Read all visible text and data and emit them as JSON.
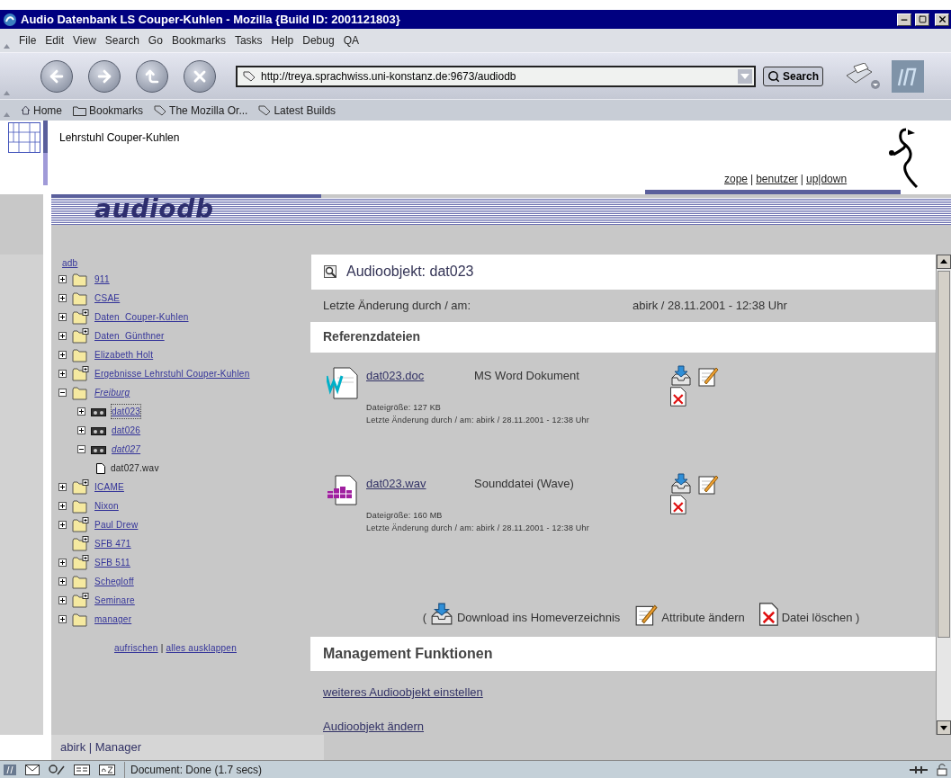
{
  "window": {
    "title": "Audio Datenbank LS Couper-Kuhlen - Mozilla {Build ID: 2001121803}"
  },
  "menu": [
    "File",
    "Edit",
    "View",
    "Search",
    "Go",
    "Bookmarks",
    "Tasks",
    "Help",
    "Debug",
    "QA"
  ],
  "toolbar": {
    "url": "http://treya.sprachwiss.uni-konstanz.de:9673/audiodb",
    "search_button": "Search"
  },
  "personal_bar": [
    {
      "label": "Home",
      "kind": "home"
    },
    {
      "label": "Bookmarks",
      "kind": "folder"
    },
    {
      "label": "The Mozilla Or...",
      "kind": "link"
    },
    {
      "label": "Latest Builds",
      "kind": "link"
    }
  ],
  "header": {
    "title": "Lehrstuhl Couper-Kuhlen",
    "links": [
      "zope",
      "benutzer",
      "up|down"
    ],
    "separator": "|"
  },
  "banner": "audiodb",
  "tree": {
    "root": "adb",
    "items": [
      {
        "label": "911",
        "kind": "folder",
        "expandable": true,
        "expanded": false,
        "selected": false
      },
      {
        "label": "CSAE",
        "kind": "folder",
        "expandable": true,
        "expanded": false,
        "selected": false
      },
      {
        "label": "Daten  Couper-Kuhlen",
        "kind": "shared",
        "expandable": true,
        "expanded": false,
        "selected": false
      },
      {
        "label": "Daten  Günthner",
        "kind": "shared",
        "expandable": true,
        "expanded": false,
        "selected": false
      },
      {
        "label": "Elizabeth Holt",
        "kind": "folder",
        "expandable": true,
        "expanded": false,
        "selected": false
      },
      {
        "label": "Ergebnisse Lehrstuhl Couper-Kuhlen",
        "kind": "shared",
        "expandable": true,
        "expanded": false,
        "selected": false
      },
      {
        "label": "Freiburg",
        "kind": "folder",
        "expandable": true,
        "expanded": true,
        "selected": false,
        "children": [
          {
            "label": "dat023",
            "kind": "tape",
            "expandable": true,
            "expanded": false,
            "selected": true
          },
          {
            "label": "dat026",
            "kind": "tape",
            "expandable": true,
            "expanded": false,
            "selected": false
          },
          {
            "label": "dat027",
            "kind": "tape",
            "expandable": true,
            "expanded": true,
            "selected": false,
            "children": [
              {
                "label": "dat027.wav",
                "kind": "file",
                "expandable": false,
                "expanded": false,
                "selected": false
              }
            ]
          }
        ]
      },
      {
        "label": "ICAME",
        "kind": "shared",
        "expandable": true,
        "expanded": false,
        "selected": false
      },
      {
        "label": "Nixon",
        "kind": "folder",
        "expandable": true,
        "expanded": false,
        "selected": false
      },
      {
        "label": "Paul Drew",
        "kind": "shared",
        "expandable": true,
        "expanded": false,
        "selected": false
      },
      {
        "label": "SFB 471",
        "kind": "shared",
        "expandable": false,
        "expanded": false,
        "selected": false
      },
      {
        "label": "SFB 511",
        "kind": "shared",
        "expandable": true,
        "expanded": false,
        "selected": false
      },
      {
        "label": "Schegloff",
        "kind": "folder",
        "expandable": true,
        "expanded": false,
        "selected": false
      },
      {
        "label": "Seminare",
        "kind": "shared",
        "expandable": true,
        "expanded": false,
        "selected": false
      },
      {
        "label": "manager",
        "kind": "folder",
        "expandable": true,
        "expanded": false,
        "selected": false
      }
    ],
    "footer_links": [
      "aufrischen",
      "alles ausklappen"
    ],
    "separator": "|"
  },
  "user_bar": "abirk | Manager",
  "main": {
    "title": "Audioobjekt: dat023",
    "last_change_label": "Letzte Änderung durch / am:",
    "last_change_value": "abirk / 28.11.2001 - 12:38 Uhr",
    "files_heading": "Referenzdateien",
    "files": [
      {
        "name": "dat023.doc",
        "type": "MS Word Dokument",
        "kind": "word",
        "size": "Dateigröße: 127 KB",
        "changed": "Letzte Änderung durch / am: abirk / 28.11.2001 - 12:38 Uhr"
      },
      {
        "name": "dat023.wav",
        "type": "Sounddatei (Wave)",
        "kind": "wave",
        "size": "Dateigröße: 160 MB",
        "changed": "Letzte Änderung durch / am: abirk / 28.11.2001 - 12:38 Uhr"
      }
    ],
    "legend": {
      "open": "(",
      "download": "Download ins Homeverzeichnis",
      "edit": "Attribute ändern",
      "delete": "Datei löschen )"
    },
    "management_heading": "Management Funktionen",
    "management_links": [
      "weiteres Audioobjekt einstellen",
      "Audioobjekt ändern"
    ]
  },
  "status_bar": "Document: Done (1.7 secs)"
}
